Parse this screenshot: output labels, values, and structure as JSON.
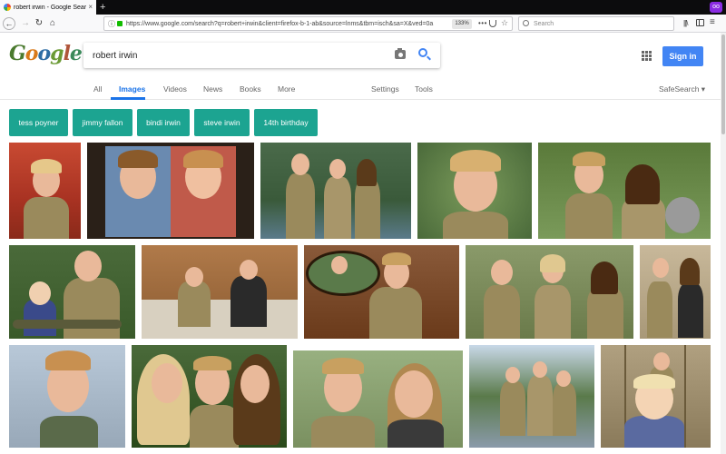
{
  "browser": {
    "tab_title": "robert irwin - Google Search",
    "tab_close": "×",
    "new_tab": "+",
    "url": "https://www.google.com/search?q=robert+irwin&client=firefox-b-1-ab&source=lnms&tbm=isch&sa=X&ved=0a",
    "zoom": "133%",
    "search_placeholder": "Search",
    "back": "←",
    "forward": "→",
    "reload": "↻",
    "home": "⌂",
    "info": "ⓘ",
    "more": "•••",
    "star": "☆",
    "library": "|||\\",
    "menu": "≡",
    "extension": "oo"
  },
  "google": {
    "logo_letters": [
      "G",
      "o",
      "o",
      "g",
      "l",
      "e"
    ],
    "query": "robert irwin",
    "sign_in": "Sign in",
    "tabs": [
      "All",
      "Images",
      "Videos",
      "News",
      "Books",
      "More"
    ],
    "active_tab": "Images",
    "tools": [
      "Settings",
      "Tools"
    ],
    "safesearch": "SafeSearch ▾",
    "chips": [
      "tess poyner",
      "jimmy fallon",
      "bindi irwin",
      "steve irwin",
      "14th birthday"
    ]
  },
  "images": [
    {
      "name": "image-red-carpet-boy",
      "bg": "#b83a2a"
    },
    {
      "name": "image-childhood-comparison",
      "bg": "#2a2018"
    },
    {
      "name": "image-family-riverside",
      "bg": "#3e5a3a"
    },
    {
      "name": "image-smiling-portrait",
      "bg": "#5e7a3e"
    },
    {
      "name": "image-snake-and-koala",
      "bg": "#6a8a4a"
    },
    {
      "name": "image-family-crocodile",
      "bg": "#4c6a3a"
    },
    {
      "name": "image-jimmy-fallon-show",
      "bg": "#a06a3a"
    },
    {
      "name": "image-father-son-split",
      "bg": "#7a4a2a"
    },
    {
      "name": "image-group-with-animals",
      "bg": "#8a9a6a"
    },
    {
      "name": "image-siblings-standing",
      "bg": "#c8b89a"
    },
    {
      "name": "image-boy-with-lizard",
      "bg": "#a8b8c8"
    },
    {
      "name": "image-mother-daughter-kiss",
      "bg": "#3a5a2a"
    },
    {
      "name": "image-siblings-closeup",
      "bg": "#8aa070"
    },
    {
      "name": "image-trio-outdoors",
      "bg": "#c0d0e0"
    },
    {
      "name": "image-toddler-swing",
      "bg": "#b0a080"
    }
  ],
  "colors": {
    "chip": "#1ca491",
    "accent": "#1a73e8",
    "sign_in": "#4285f4"
  }
}
